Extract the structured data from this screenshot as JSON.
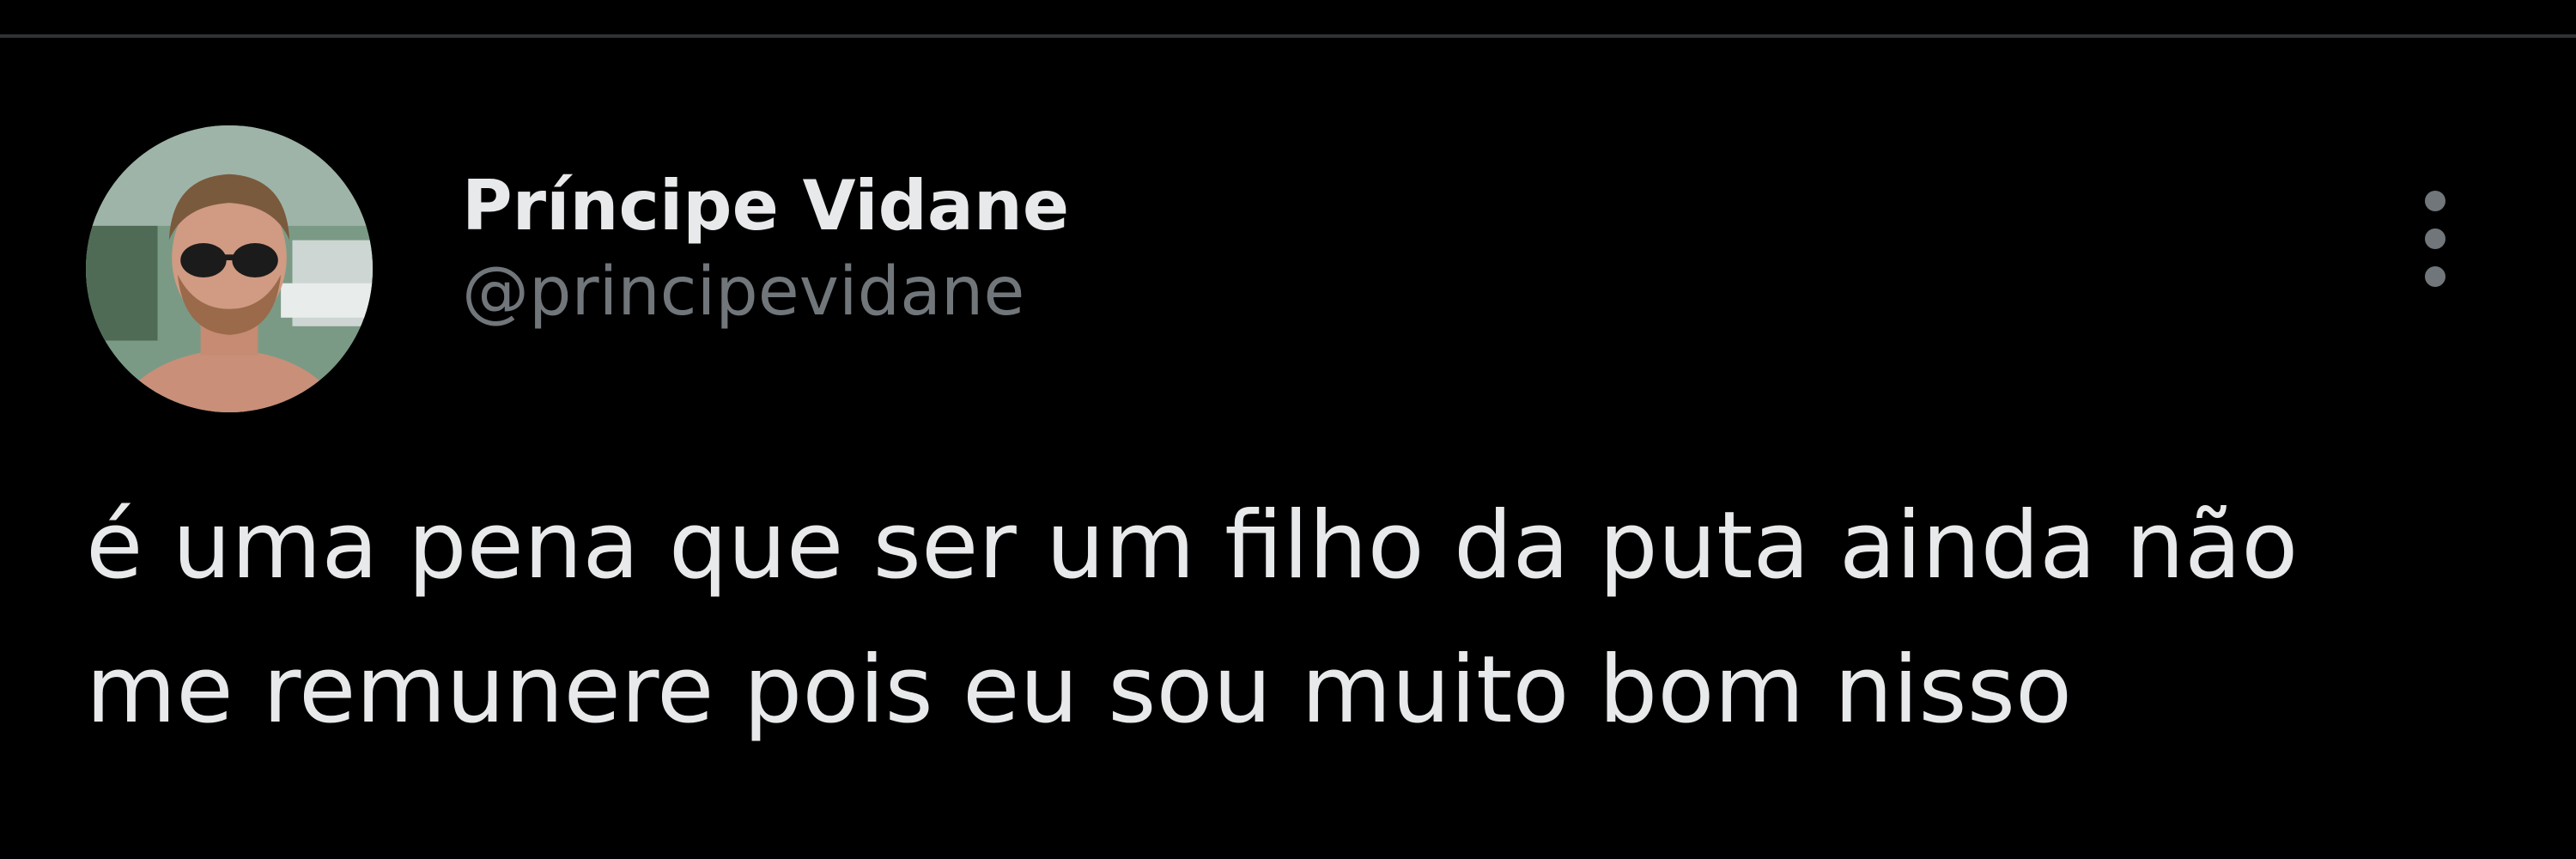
{
  "tweet": {
    "author": {
      "display_name": "Príncipe Vidane",
      "handle": "@principevidane",
      "avatar": "profile-photo-man-sunglasses"
    },
    "text": "é uma pena que ser um filho da puta ainda não\nme remunere pois eu sou muito bom nisso",
    "more_icon": "vertical-ellipsis-icon"
  },
  "colors": {
    "background": "#000000",
    "primary_text": "#e7e9ea",
    "secondary_text": "#71767b",
    "divider": "#2f3336"
  }
}
